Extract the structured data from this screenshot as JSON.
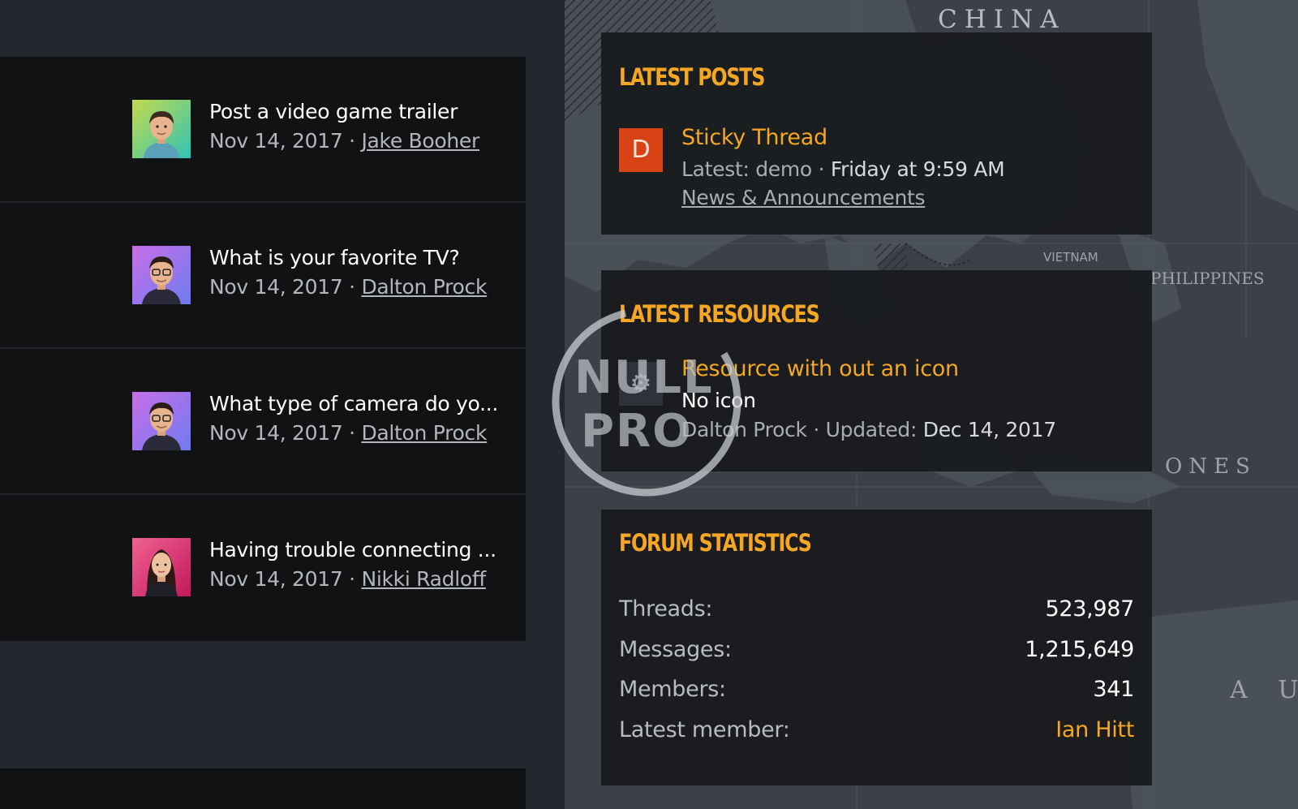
{
  "recent_threads": [
    {
      "title": "Post a video game trailer",
      "date": "Nov 14, 2017",
      "separator": "·",
      "author": "Jake Booher",
      "avatar_icon": "avatar-man-green"
    },
    {
      "title": "What is your favorite TV?",
      "date": "Nov 14, 2017",
      "separator": "·",
      "author": "Dalton Prock",
      "avatar_icon": "avatar-man-glasses-purple"
    },
    {
      "title": "What type of camera do yo...",
      "date": "Nov 14, 2017",
      "separator": "·",
      "author": "Dalton Prock",
      "avatar_icon": "avatar-man-glasses-purple"
    },
    {
      "title": "Having trouble connecting ...",
      "date": "Nov 14, 2017",
      "separator": "·",
      "author": "Nikki Radloff",
      "avatar_icon": "avatar-woman-pink"
    }
  ],
  "latest_posts": {
    "heading": "Latest posts",
    "post": {
      "avatar_letter": "D",
      "title": "Sticky Thread",
      "latest_prefix": "Latest: demo",
      "separator": "·",
      "time": "Friday at 9:59 AM",
      "forum": "News & Announcements"
    }
  },
  "latest_resources": {
    "heading": "Latest resources",
    "resource": {
      "icon": "gear-icon",
      "title": "Resource with out an icon",
      "description": "No icon",
      "author": "Dalton Prock",
      "separator": "·",
      "updated_label": "Updated:",
      "updated_date": "Dec 14, 2017"
    }
  },
  "forum_statistics": {
    "heading": "Forum statistics",
    "rows": [
      {
        "label": "Threads:",
        "value": "523,987"
      },
      {
        "label": "Messages:",
        "value": "1,215,649"
      },
      {
        "label": "Members:",
        "value": "341"
      },
      {
        "label": "Latest member:",
        "value": "Ian Hitt"
      }
    ]
  },
  "map_labels": {
    "china": "CHINA",
    "vietnam": "VIETNAM",
    "philippines": "PHILIPPINES",
    "indonesia_partial": "ONES",
    "australia_partial": "A U"
  },
  "watermark": {
    "line1": "NULL",
    "line2": "PRO"
  },
  "colors": {
    "accent": "#f5a623",
    "background": "#24272d",
    "panel": "#16181b",
    "avatar_d": "#d84315"
  }
}
